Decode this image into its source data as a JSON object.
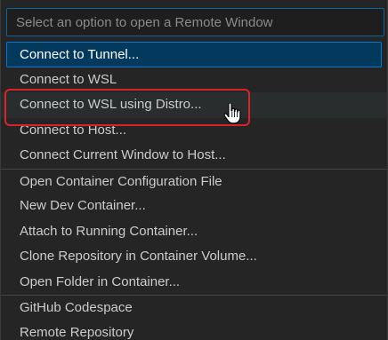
{
  "search": {
    "placeholder": "Select an option to open a Remote Window"
  },
  "items": [
    {
      "label": "Connect to Tunnel..."
    },
    {
      "label": "Connect to WSL"
    },
    {
      "label": "Connect to WSL using Distro..."
    },
    {
      "label": "Connect to Host..."
    },
    {
      "label": "Connect Current Window to Host..."
    },
    {
      "label": "Open Container Configuration File"
    },
    {
      "label": "New Dev Container..."
    },
    {
      "label": "Attach to Running Container..."
    },
    {
      "label": "Clone Repository in Container Volume..."
    },
    {
      "label": "Open Folder in Container..."
    },
    {
      "label": "GitHub Codespace"
    },
    {
      "label": "Remote Repository"
    }
  ],
  "colors": {
    "accent": "#0078d4",
    "active_bg": "#04395e",
    "annotation_ring": "#d6242a",
    "background": "#252526"
  },
  "icons": {
    "cursor": "hand-pointer-icon"
  }
}
